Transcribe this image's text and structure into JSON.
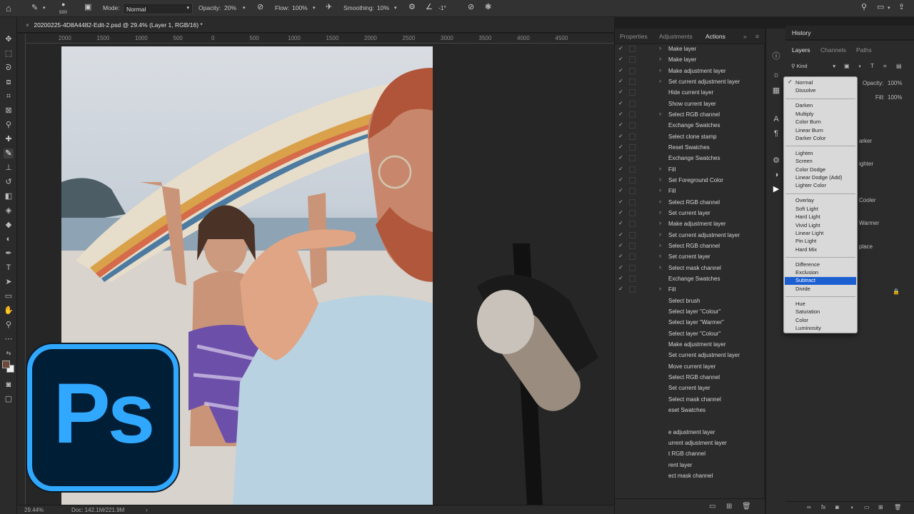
{
  "options_bar": {
    "brush_size": "500",
    "mode_label": "Mode:",
    "mode_value": "Normal",
    "opacity_label": "Opacity:",
    "opacity_value": "20%",
    "flow_label": "Flow:",
    "flow_value": "100%",
    "smoothing_label": "Smoothing:",
    "smoothing_value": "10%",
    "angle_value": "-1°"
  },
  "document": {
    "tab_title": "20200225-4D8A4482-Edit-2.psd @ 29.4% (Layer 1, RGB/16) *",
    "ruler_ticks": [
      "2000",
      "1500",
      "1000",
      "500",
      "0",
      "500",
      "1000",
      "1500",
      "2000",
      "2500",
      "3000",
      "3500",
      "4000",
      "4500"
    ]
  },
  "status_bar": {
    "zoom": "29.44%",
    "doc_size": "Doc: 142.1M/221.9M"
  },
  "actions_panel": {
    "tabs": [
      "Properties",
      "Adjustments",
      "Actions"
    ],
    "active_tab": "Actions",
    "items": [
      {
        "label": "Make layer",
        "expandable": true
      },
      {
        "label": "Make layer",
        "expandable": true
      },
      {
        "label": "Make adjustment layer",
        "expandable": true
      },
      {
        "label": "Set current adjustment layer",
        "expandable": true
      },
      {
        "label": "Hide current layer",
        "expandable": false
      },
      {
        "label": "Show current layer",
        "expandable": false
      },
      {
        "label": "Select RGB channel",
        "expandable": true
      },
      {
        "label": "Exchange Swatches",
        "expandable": false
      },
      {
        "label": "Select clone stamp",
        "expandable": false
      },
      {
        "label": "Reset Swatches",
        "expandable": false
      },
      {
        "label": "Exchange Swatches",
        "expandable": false
      },
      {
        "label": "Fill",
        "expandable": true
      },
      {
        "label": "Set Foreground Color",
        "expandable": true
      },
      {
        "label": "Fill",
        "expandable": true
      },
      {
        "label": "Select RGB channel",
        "expandable": true
      },
      {
        "label": "Set current layer",
        "expandable": true
      },
      {
        "label": "Make adjustment layer",
        "expandable": true
      },
      {
        "label": "Set current adjustment layer",
        "expandable": true
      },
      {
        "label": "Select RGB channel",
        "expandable": true
      },
      {
        "label": "Set current layer",
        "expandable": true
      },
      {
        "label": "Select mask channel",
        "expandable": true
      },
      {
        "label": "Exchange Swatches",
        "expandable": false
      },
      {
        "label": "Fill",
        "expandable": true
      },
      {
        "label": "Select brush",
        "expandable": false
      },
      {
        "label": "Select layer \"Colour\"",
        "expandable": false
      },
      {
        "label": "Select layer \"Warmer\"",
        "expandable": false
      },
      {
        "label": "Select layer \"Colour\"",
        "expandable": false
      },
      {
        "label": "Make adjustment layer",
        "expandable": false
      },
      {
        "label": "Set current adjustment layer",
        "expandable": false
      },
      {
        "label": "Move current layer",
        "expandable": false
      },
      {
        "label": "Select RGB channel",
        "expandable": false
      },
      {
        "label": "Set current layer",
        "expandable": false
      },
      {
        "label": "Select mask channel",
        "expandable": false
      },
      {
        "label": "eset Swatches",
        "expandable": false
      },
      {
        "label": "",
        "expandable": false
      },
      {
        "label": "e adjustment layer",
        "expandable": false
      },
      {
        "label": "urrent adjustment layer",
        "expandable": false
      },
      {
        "label": "t RGB channel",
        "expandable": false
      },
      {
        "label": "rent layer",
        "expandable": false
      },
      {
        "label": "ect mask channel",
        "expandable": false
      }
    ]
  },
  "history_panel": {
    "title": "History"
  },
  "layers_panel": {
    "tabs": [
      "Layers",
      "Channels",
      "Paths"
    ],
    "active_tab": "Layers",
    "filter_label": "Kind",
    "opacity_label": "Opacity:",
    "opacity_value": "100%",
    "fill_label": "Fill:",
    "fill_value": "100%",
    "layer_fragments": [
      "arker",
      "ighter",
      "Cooler",
      "Warmer",
      "place"
    ]
  },
  "blend_menu": {
    "groups": [
      [
        "Normal",
        "Dissolve"
      ],
      [
        "Darken",
        "Multiply",
        "Color Burn",
        "Linear Burn",
        "Darker Color"
      ],
      [
        "Lighten",
        "Screen",
        "Color Dodge",
        "Linear Dodge (Add)",
        "Lighter Color"
      ],
      [
        "Overlay",
        "Soft Light",
        "Hard Light",
        "Vivid Light",
        "Linear Light",
        "Pin Light",
        "Hard Mix"
      ],
      [
        "Difference",
        "Exclusion",
        "Subtract",
        "Divide"
      ],
      [
        "Hue",
        "Saturation",
        "Color",
        "Luminosity"
      ]
    ],
    "checked": "Normal",
    "highlighted": "Subtract"
  },
  "logo": {
    "text": "Ps",
    "border_color": "#31a8ff",
    "bg_color": "#001e36"
  },
  "icons": [
    "home-icon",
    "brush-tool-icon",
    "airbrush-icon",
    "smoothing-gear-icon",
    "angle-icon",
    "pressure-icon",
    "symmetry-icon",
    "search-icon",
    "workspace-icon",
    "share-icon"
  ]
}
